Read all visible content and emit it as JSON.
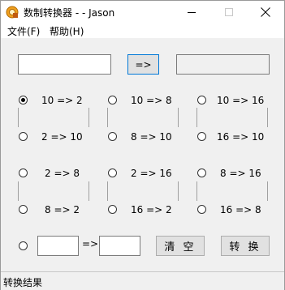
{
  "window": {
    "title": "数制转换器 - - Jason"
  },
  "menu": {
    "file": "文件(F)",
    "help": "帮助(H)"
  },
  "top": {
    "convert_arrow_label": "=>"
  },
  "options": [
    {
      "label": "10 => 2",
      "checked": true
    },
    {
      "label": "10 => 8",
      "checked": false
    },
    {
      "label": "10 => 16",
      "checked": false
    },
    {
      "label": "2 => 10",
      "checked": false
    },
    {
      "label": "8 => 10",
      "checked": false
    },
    {
      "label": "16 => 10",
      "checked": false
    },
    {
      "label": "2 => 8",
      "checked": false
    },
    {
      "label": "2 => 16",
      "checked": false
    },
    {
      "label": "8 => 16",
      "checked": false
    },
    {
      "label": "8 => 2",
      "checked": false
    },
    {
      "label": "16 => 2",
      "checked": false
    },
    {
      "label": "16 => 8",
      "checked": false
    }
  ],
  "custom": {
    "arrow": "=>"
  },
  "buttons": {
    "clear": "清 空",
    "convert": "转 换"
  },
  "status": {
    "text": "转换结果"
  }
}
